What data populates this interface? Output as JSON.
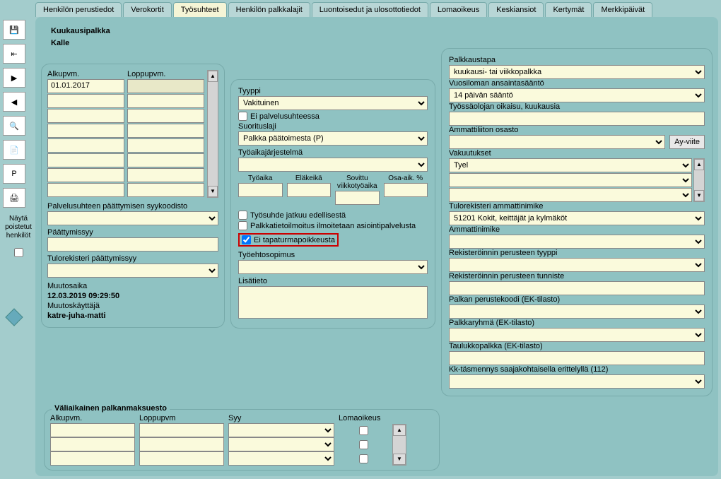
{
  "toolbar": {
    "showDeleted": "Näytä poistetut henkilöt"
  },
  "tabs": {
    "items": [
      "Henkilön perustiedot",
      "Verokortit",
      "Työsuhteet",
      "Henkilön palkkalajit",
      "Luontoisedut ja ulosottotiedot",
      "Lomaoikeus",
      "Keskiansiot",
      "Kertymät",
      "Merkkipäivät"
    ]
  },
  "header": {
    "salaryType": "Kuukausipalkka",
    "personName": "Kalle"
  },
  "col1": {
    "alkupvmLabel": "Alkupvm.",
    "loppupvmLabel": "Loppupvm.",
    "alkupvmValue": "01.01.2017",
    "endReasonLabel": "Palvelusuhteen päättymisen syykoodisto",
    "paattymissyyLabel": "Päättymissyy",
    "tulorekPaattyLabel": "Tulorekisteri päättymissyy",
    "muutosaikaLabel": "Muutosaika",
    "muutosaikaValue": "12.03.2019 09:29:50",
    "muutoskayttajaLabel": "Muutoskäyttäjä",
    "muutoskayttajaValue": "katre-juha-matti"
  },
  "col2": {
    "tyyppiLabel": "Tyyppi",
    "tyyppiValue": "Vakituinen",
    "eiPalvelusuhteessa": "Ei palvelusuhteessa",
    "suorituslajLabel": "Suorituslaji",
    "suorituslajValue": "Palkka päätoimesta (P)",
    "tyoaikajarjLabel": "Työaikajärjestelmä",
    "tyoaikaLabel": "Työaika",
    "elakeikaLabel": "Eläkeikä",
    "sovittuLabel": "Sovittu viikkotyöaika",
    "osaaikLabel": "Osa-aik. %",
    "jatkuuLabel": "Työsuhde jatkuu edellisestä",
    "palkkatietoLabel": "Palkkatietoilmoitus ilmoitetaan asiointipalvelusta",
    "eiTapaturmaLabel": "Ei tapaturmapoikkeusta",
    "tyoehtoLabel": "Työehtosopimus",
    "lisatietoLabel": "Lisätieto"
  },
  "col3": {
    "palkkaustapLabel": "Palkkaustapa",
    "palkkaustapValue": "kuukausi- tai viikkopalkka",
    "vuosilomaLabel": "Vuosiloman ansaintasääntö",
    "vuosilomaValue": "14 päivän sääntö",
    "tyossaoloLabel": "Työssäolojan oikaisu, kuukausia",
    "ammattiliittoLabel": "Ammattiliiton osasto",
    "ayViite": "Ay-viite",
    "vakuutuksetLabel": "Vakuutukset",
    "vakuutuksetValue": "Tyel",
    "tulorekAmmattiLabel": "Tulorekisteri ammattinimike",
    "tulorekAmmattiValue": "51201 Kokit, keittäjät ja kylmäköt",
    "ammattinimikeLabel": "Ammattinimike",
    "rekPerusteTyyppiLabel": "Rekisteröinnin perusteen tyyppi",
    "rekPerusteTunnisteLabel": "Rekisteröinnin perusteen tunniste",
    "palkanPerusteLabel": "Palkan perustekoodi (EK-tilasto)",
    "palkkaryhmaLabel": "Palkkaryhmä (EK-tilasto)",
    "taulukkopalkLabel": "Taulukkopalkka (EK-tilasto)",
    "kktasmennysLabel": "Kk-täsmennys saajakohtaisella erittelyllä (112)"
  },
  "temp": {
    "title": "Väliaikainen palkanmaksuesto",
    "alkupvm": "Alkupvm.",
    "loppupvm": "Loppupvm",
    "syy": "Syy",
    "lomaoikeus": "Lomaoikeus"
  }
}
